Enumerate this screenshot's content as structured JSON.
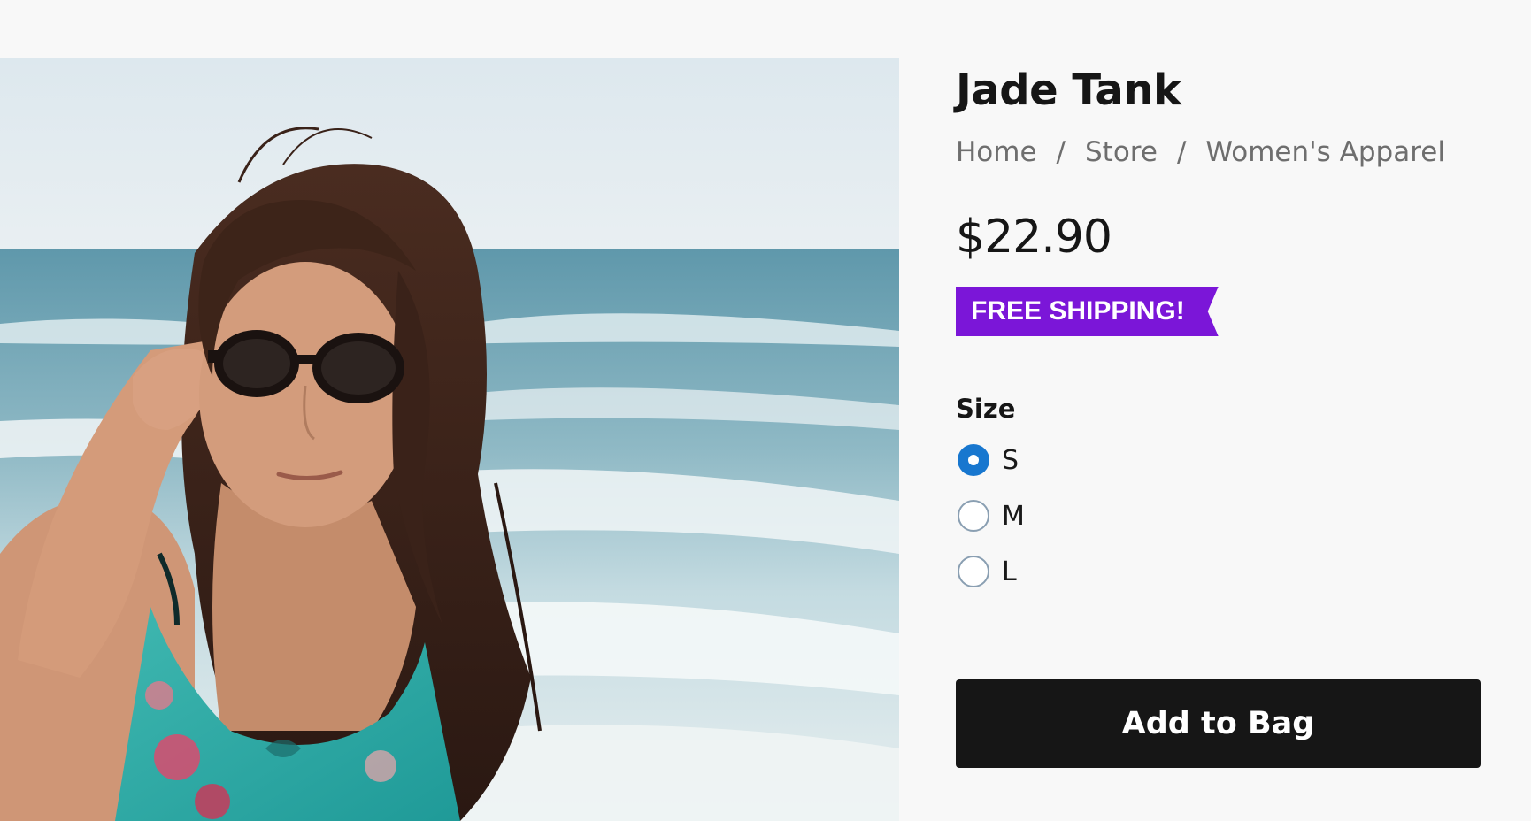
{
  "product": {
    "title": "Jade Tank",
    "price": "$22.90",
    "badge": "FREE SHIPPING!",
    "image_alt": "Woman with sunglasses at the beach"
  },
  "breadcrumb": {
    "items": [
      "Home",
      "Store",
      "Women's Apparel"
    ],
    "separator": "/"
  },
  "size": {
    "label": "Size",
    "options": [
      {
        "label": "S",
        "selected": true
      },
      {
        "label": "M",
        "selected": false
      },
      {
        "label": "L",
        "selected": false
      }
    ]
  },
  "actions": {
    "add_to_bag": "Add to Bag"
  },
  "colors": {
    "badge": "#7b16d8",
    "radio_selected": "#1877cf",
    "button": "#161616",
    "background": "#f8f8f8"
  }
}
